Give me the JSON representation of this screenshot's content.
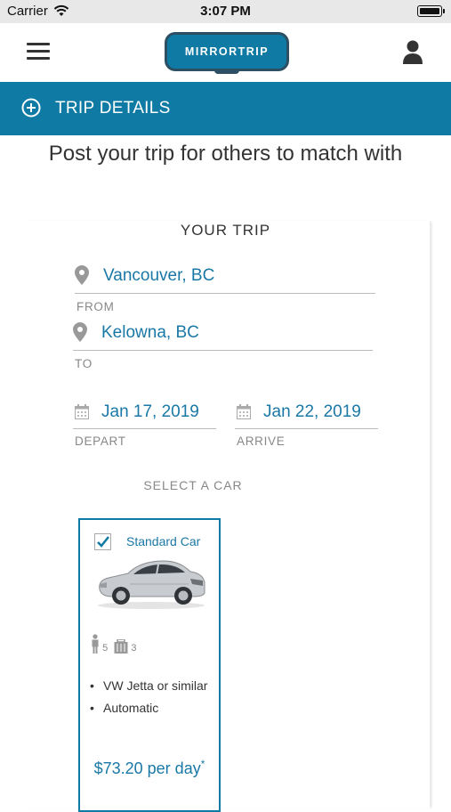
{
  "status_bar": {
    "carrier": "Carrier",
    "time": "3:07 PM"
  },
  "header": {
    "logo_text": "MIRRORTRIP"
  },
  "banner": {
    "title": "TRIP DETAILS"
  },
  "headline": "Post your trip for others to match with",
  "trip": {
    "section_title": "YOUR TRIP",
    "from": {
      "value": "Vancouver, BC",
      "label": "FROM"
    },
    "to": {
      "value": "Kelowna, BC",
      "label": "TO"
    },
    "depart": {
      "value": "Jan 17, 2019",
      "label": "DEPART"
    },
    "arrive": {
      "value": "Jan 22, 2019",
      "label": "ARRIVE"
    },
    "select_car_label": "SELECT A CAR"
  },
  "car": {
    "name": "Standard Car",
    "selected": true,
    "passengers": "5",
    "bags": "3",
    "features": [
      "VW Jetta or similar",
      "Automatic"
    ],
    "price": "$73.20 per day",
    "price_note": "*"
  },
  "colors": {
    "accent": "#0f7aa3",
    "logo_border": "#2d4f63",
    "text_link": "#1a78a6"
  }
}
